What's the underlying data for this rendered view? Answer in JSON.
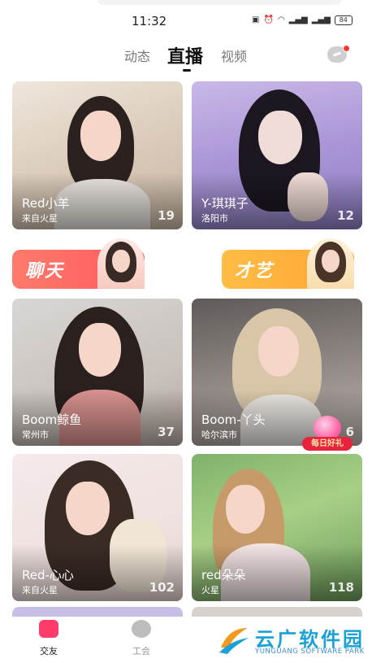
{
  "status_bar": {
    "time": "11:32",
    "icons": [
      "nfc-icon",
      "alarm-icon",
      "wifi-icon",
      "signal-icon",
      "signal-icon"
    ],
    "battery": "84"
  },
  "tabs": [
    {
      "label": "动态",
      "active": false
    },
    {
      "label": "直播",
      "active": true
    },
    {
      "label": "视频",
      "active": false
    }
  ],
  "cards": [
    {
      "name": "Red小羊",
      "location": "来自火星",
      "count": "19"
    },
    {
      "name": "Y-琪琪子",
      "location": "洛阳市",
      "count": "12"
    },
    {
      "name": "Boom鲸鱼",
      "location": "常州市",
      "count": "37"
    },
    {
      "name": "Boom-丫头",
      "location": "哈尔滨市",
      "count": "6"
    },
    {
      "name": "Red-心心",
      "location": "来自火星",
      "count": "102"
    },
    {
      "name": "red朵朵",
      "location": "火星",
      "count": "118"
    }
  ],
  "banners": [
    {
      "label": "聊天",
      "color": "#ff6a5c"
    },
    {
      "label": "才艺",
      "color": "#ffb23a"
    }
  ],
  "gift_badge": {
    "label": "每日好礼"
  },
  "bottom_nav": [
    {
      "label": "交友",
      "active": true
    },
    {
      "label": "工会",
      "active": false
    }
  ],
  "watermark": {
    "cn": "云广软件园",
    "en": "YUNGUANG SOFTWARE PARK"
  },
  "colors": {
    "accent": "#ff3b6b",
    "inactive": "#9a9a9a"
  }
}
